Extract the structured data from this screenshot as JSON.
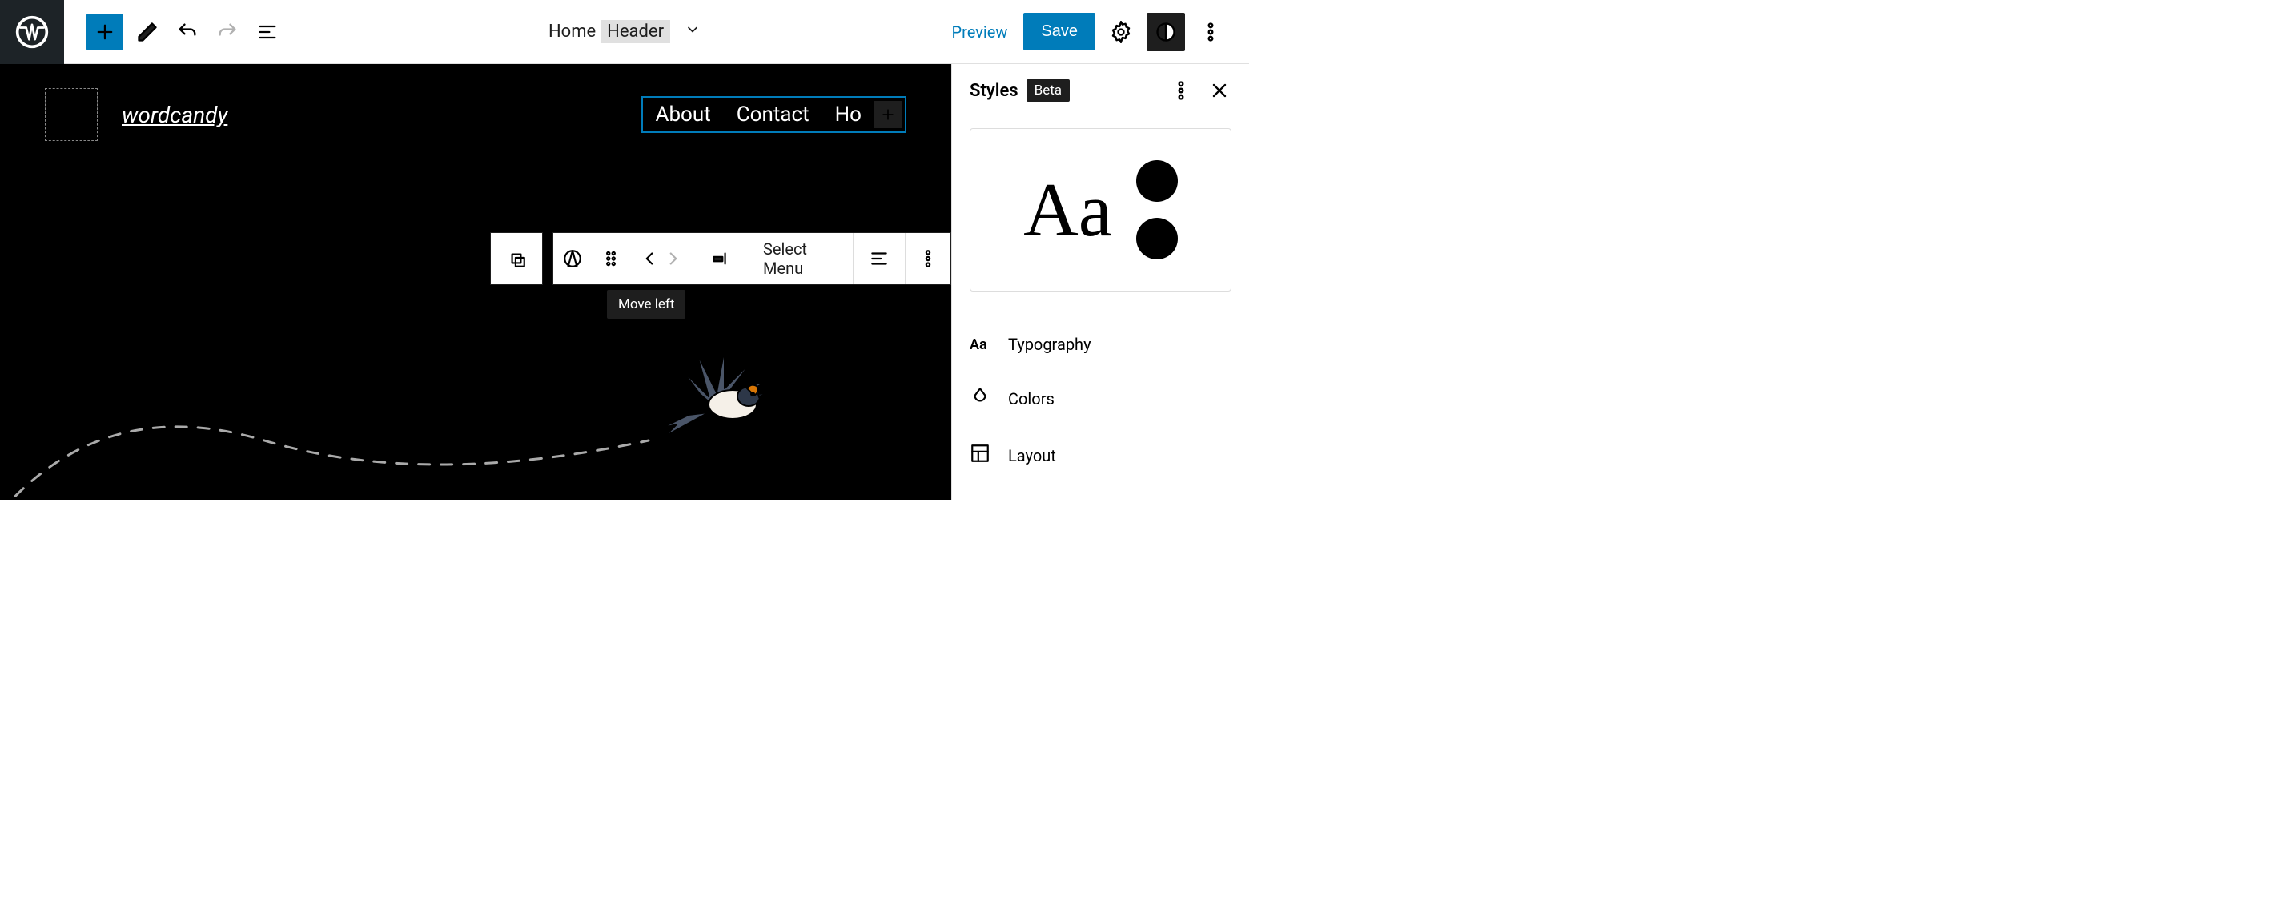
{
  "toolbar": {
    "preview": "Preview",
    "save": "Save"
  },
  "breadcrumb": {
    "root": "Home",
    "current": "Header"
  },
  "canvas": {
    "site_title": "wordcandy",
    "nav_items": [
      "About",
      "Contact",
      "Ho"
    ]
  },
  "block_toolbar": {
    "select_menu": "Select Menu",
    "tooltip": "Move left"
  },
  "sidebar": {
    "title": "Styles",
    "badge": "Beta",
    "preview_text": "Aa",
    "items": [
      {
        "icon": "aa",
        "label": "Typography"
      },
      {
        "icon": "drop",
        "label": "Colors"
      },
      {
        "icon": "layout",
        "label": "Layout"
      }
    ]
  },
  "colors": {
    "accent": "#007cba",
    "dark": "#1e1e1e"
  }
}
